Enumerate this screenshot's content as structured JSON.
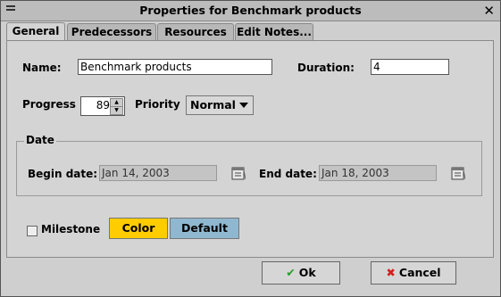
{
  "window": {
    "title": "Properties for Benchmark products"
  },
  "tabs": [
    {
      "label": "General"
    },
    {
      "label": "Predecessors"
    },
    {
      "label": "Resources"
    },
    {
      "label": "Edit Notes..."
    }
  ],
  "form": {
    "name_label": "Name:",
    "name_value": "Benchmark products",
    "duration_label": "Duration:",
    "duration_value": "4",
    "progress_label": "Progress",
    "progress_value": "89",
    "priority_label": "Priority",
    "priority_value": "Normal",
    "date_group_label": "Date",
    "begin_label": "Begin date:",
    "begin_value": "Jan 14, 2003",
    "end_label": "End date:",
    "end_value": "Jan 18, 2003",
    "milestone_label": "Milestone",
    "color_label": "Color",
    "default_label": "Default"
  },
  "footer": {
    "ok_label": "Ok",
    "cancel_label": "Cancel"
  },
  "colors": {
    "color_button": "#ffcc00",
    "default_button": "#8fb8d0"
  }
}
